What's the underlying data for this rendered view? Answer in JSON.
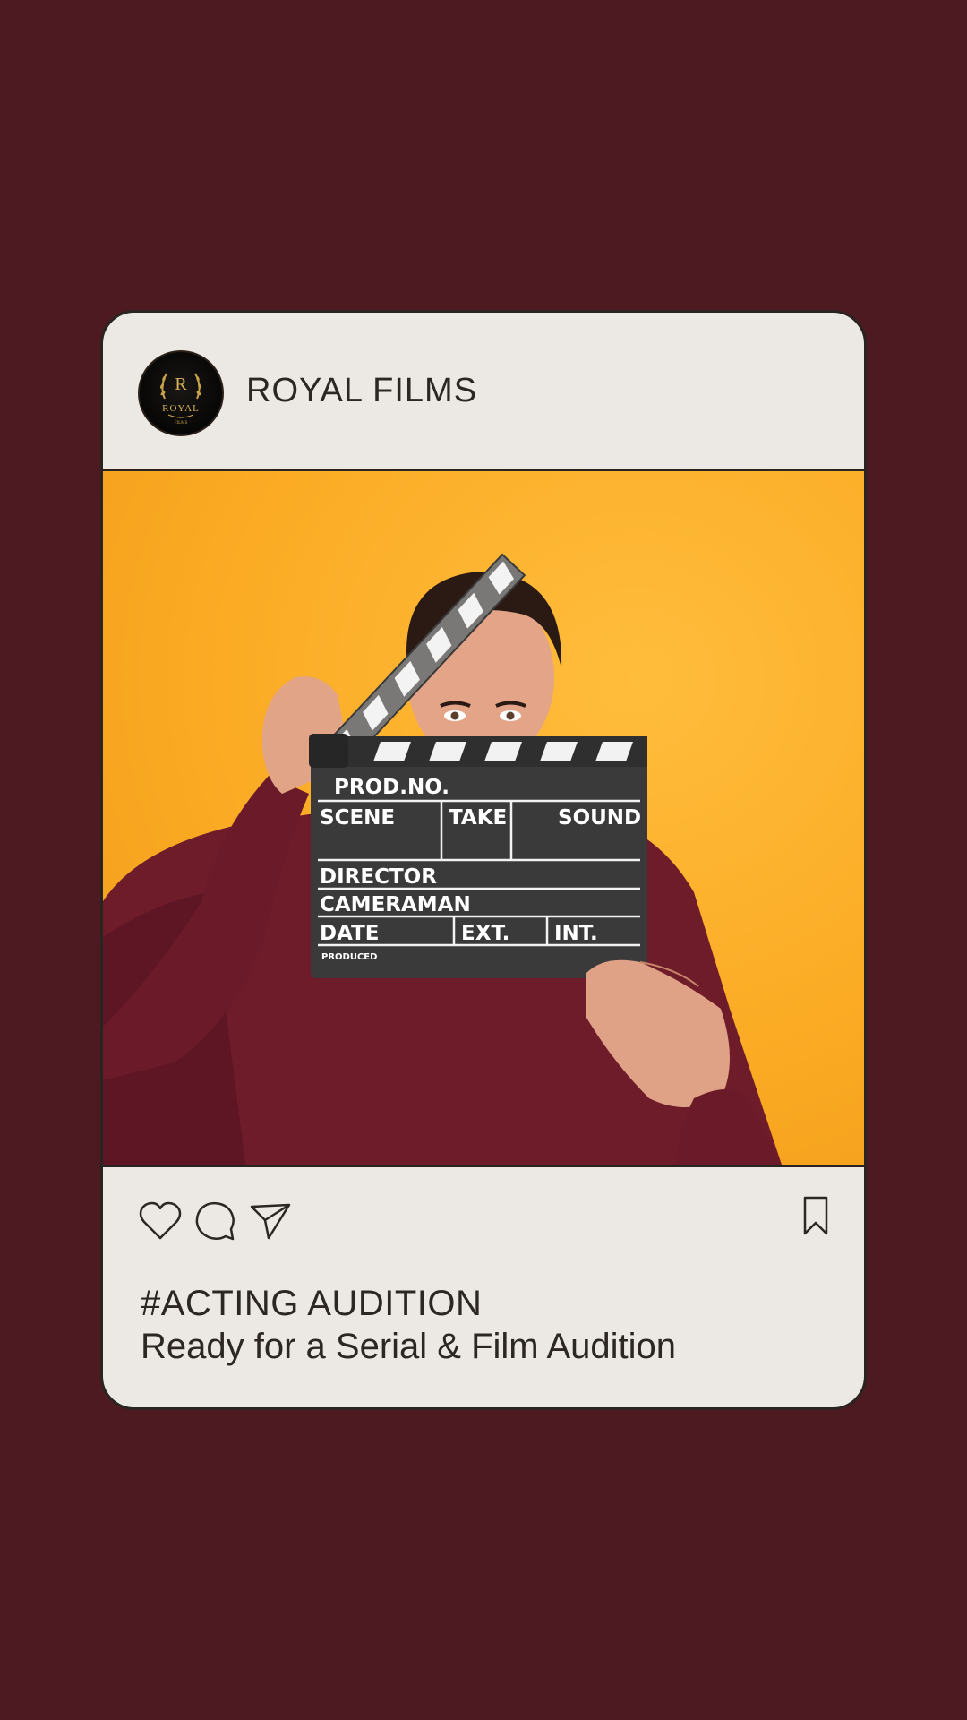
{
  "post": {
    "account_name": "ROYAL FILMS",
    "avatar_logo": {
      "initial": "R",
      "word": "ROYAL",
      "sub": "FILMS"
    },
    "image": {
      "clapperboard": {
        "prod_no": "PROD.NO.",
        "scene": "SCENE",
        "take": "TAKE",
        "sound": "SOUND",
        "director": "DIRECTOR",
        "cameraman": "CAMERAMAN",
        "date": "DATE",
        "ext": "EXT.",
        "int": "INT.",
        "produced": "PRODUCED"
      }
    },
    "actions": {
      "like_icon": "heart-icon",
      "comment_icon": "comment-icon",
      "share_icon": "send-icon",
      "save_icon": "bookmark-icon"
    },
    "caption": {
      "hashtag": "#ACTING AUDITION",
      "text": "Ready for a Serial & Film Audition"
    }
  },
  "colors": {
    "background": "#4e1a21",
    "card": "#ece9e5",
    "photo_bg": "#fbab24",
    "text": "#2c2722"
  }
}
